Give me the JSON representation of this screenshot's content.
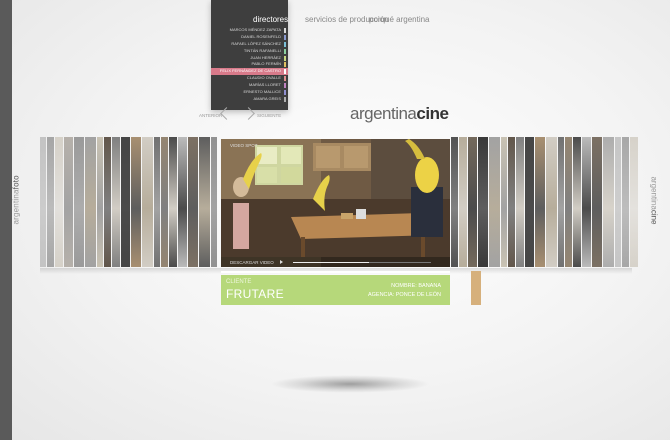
{
  "side": {
    "left_light": "argentina",
    "left_bold": "foto",
    "right_light": "argentina",
    "right_bold": "cine"
  },
  "nav": {
    "directors": "directores",
    "services": "servicios de producción",
    "why": "porqué argentina"
  },
  "directors": [
    {
      "name": "Marcos Méndez Zapata",
      "color": "#d9d9d9"
    },
    {
      "name": "Daniel Rosenfeld",
      "color": "#8a9ad0"
    },
    {
      "name": "Rafael López Sánchez",
      "color": "#7cc0d8"
    },
    {
      "name": "Tintán Rafanelli",
      "color": "#8bd0a0"
    },
    {
      "name": "Juan Herráez",
      "color": "#c8d880"
    },
    {
      "name": "Pablo Fermín",
      "color": "#e0c060"
    },
    {
      "name": "Felix Fernández de Castro",
      "color": "#ffffff",
      "active": true
    },
    {
      "name": "Claudio Ovalle",
      "color": "#e09090"
    },
    {
      "name": "Marías Lloret",
      "color": "#c080c0"
    },
    {
      "name": "Ernesto Mallice",
      "color": "#9090d0"
    },
    {
      "name": "Amara Greis",
      "color": "#b0b0b0"
    }
  ],
  "paging": {
    "prev": "anterior",
    "next": "siguiente"
  },
  "logo": {
    "light": "argentina",
    "bold": "cine"
  },
  "video": {
    "label": "video spot",
    "download": "descargar video",
    "progress": 0.55
  },
  "info": {
    "client_label": "cliente",
    "client_name": "frutare",
    "name_line": "nombre: banana",
    "agency_line": "agencia: ponce de león"
  },
  "colors": {
    "info_green": "#b6d87a",
    "accent_tan": "#d6b07c",
    "active_director": "#d87a8a",
    "panel_dark": "#3e3e3e"
  }
}
